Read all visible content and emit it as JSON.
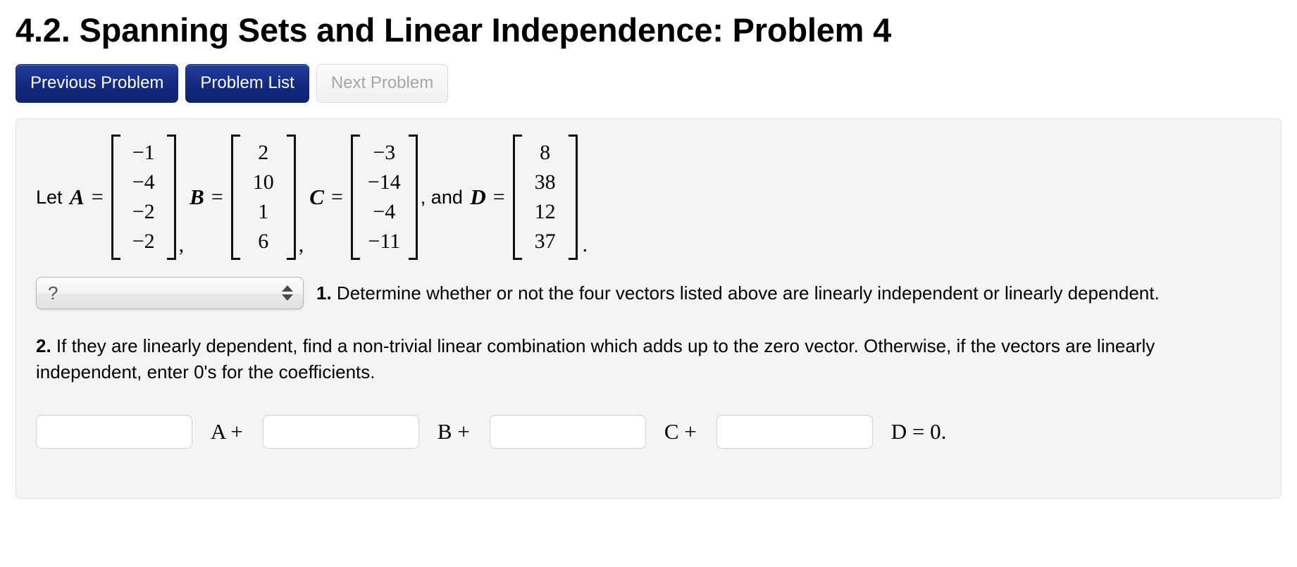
{
  "page": {
    "title": "4.2. Spanning Sets and Linear Independence: Problem 4"
  },
  "nav": {
    "previous_label": "Previous Problem",
    "problem_list_label": "Problem List",
    "next_label": "Next Problem"
  },
  "problem": {
    "lead_text": "Let ",
    "and_text": ", and ",
    "comma": ",",
    "equals": "=",
    "period": ".",
    "vectors": [
      {
        "name": "A",
        "entries": [
          "−1",
          "−4",
          "−2",
          "−2"
        ]
      },
      {
        "name": "B",
        "entries": [
          "2",
          "10",
          "1",
          "6"
        ]
      },
      {
        "name": "C",
        "entries": [
          "−3",
          "−14",
          "−4",
          "−11"
        ]
      },
      {
        "name": "D",
        "entries": [
          "8",
          "38",
          "12",
          "37"
        ]
      }
    ],
    "question1": {
      "number": "1.",
      "text": " Determine whether or not the four vectors listed above are linearly independent or linearly dependent.",
      "select_value": "?"
    },
    "question2": {
      "number": "2.",
      "text": " If they are linearly dependent, find a non-trivial linear combination which adds up to the zero vector. Otherwise, if the vectors are linearly independent, enter 0's for the coefficients."
    },
    "answer_row": {
      "inputs": [
        {
          "value": "",
          "placeholder": ""
        },
        {
          "value": "",
          "placeholder": ""
        },
        {
          "value": "",
          "placeholder": ""
        },
        {
          "value": "",
          "placeholder": ""
        }
      ],
      "labels": [
        "A +",
        "B +",
        "C +",
        "D = 0."
      ]
    }
  },
  "colors": {
    "button_blue": "#152c85",
    "panel_bg": "#f4f4f4",
    "disabled_text": "#a6a6a6"
  }
}
